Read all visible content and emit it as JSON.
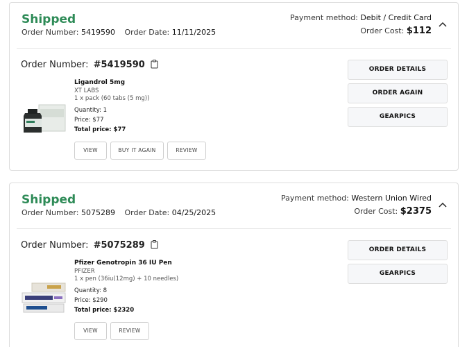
{
  "orders": [
    {
      "status": "Shipped",
      "order_number_label": "Order Number:",
      "order_number": "5419590",
      "order_date_label": "Order Date:",
      "order_date": "11/11/2025",
      "payment_label": "Payment method:",
      "payment_method": "Debit / Credit Card",
      "cost_label": "Order Cost:",
      "cost": "$112",
      "detail_order_label": "Order Number:",
      "detail_order_number": "#5419590",
      "item": {
        "name": "Ligandrol 5mg",
        "brand": "XT LABS",
        "pack": "1 x pack (60 tabs (5 mg))",
        "quantity": "Quantity: 1",
        "price": "Price: $77",
        "total": "Total price: $77"
      },
      "item_buttons": [
        "VIEW",
        "BUY IT AGAIN",
        "REVIEW"
      ],
      "side_buttons": [
        "ORDER DETAILS",
        "ORDER AGAIN",
        "GEARPICS"
      ]
    },
    {
      "status": "Shipped",
      "order_number_label": "Order Number:",
      "order_number": "5075289",
      "order_date_label": "Order Date:",
      "order_date": "04/25/2025",
      "payment_label": "Payment method:",
      "payment_method": "Western Union Wired",
      "cost_label": "Order Cost:",
      "cost": "$2375",
      "detail_order_label": "Order Number:",
      "detail_order_number": "#5075289",
      "item": {
        "name": "Pfizer Genotropin 36 IU Pen",
        "brand": "PFIZER",
        "pack": "1 x pen (36iu(12mg) + 10 needles)",
        "quantity": "Quantity: 8",
        "price": "Price: $290",
        "total": "Total price: $2320"
      },
      "item_buttons": [
        "VIEW",
        "REVIEW"
      ],
      "side_buttons": [
        "ORDER DETAILS",
        "GEARPICS"
      ]
    }
  ],
  "colors": {
    "status_green": "#2e8b57",
    "border": "#dcdcdc",
    "button_bg": "#f6f7f9"
  },
  "icons": {
    "toggle": "chevron-up-icon",
    "copy": "clipboard-icon"
  }
}
